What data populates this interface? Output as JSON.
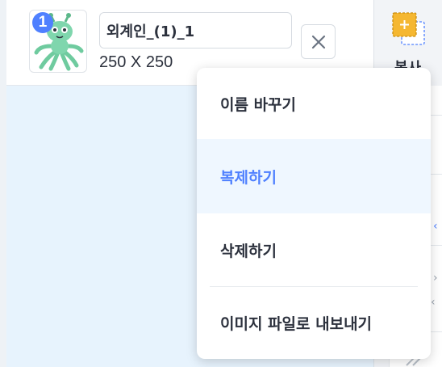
{
  "sprite": {
    "number": "1",
    "name": "외계인_(1)_1",
    "size": "250 X 250"
  },
  "toolbar": {
    "copy_label": "복사"
  },
  "context_menu": {
    "items": [
      {
        "label": "이름 바꾸기"
      },
      {
        "label": "복제하기"
      },
      {
        "label": "삭제하기"
      },
      {
        "label": "이미지 파일로 내보내기"
      }
    ]
  },
  "colors": {
    "accent": "#4f80ff",
    "menu_active_bg": "#eff7ff",
    "canvas_bg": "#e7f3fd"
  },
  "icons": {
    "close": "close-icon",
    "copy": "copy-icon",
    "sprite": "alien-icon"
  }
}
